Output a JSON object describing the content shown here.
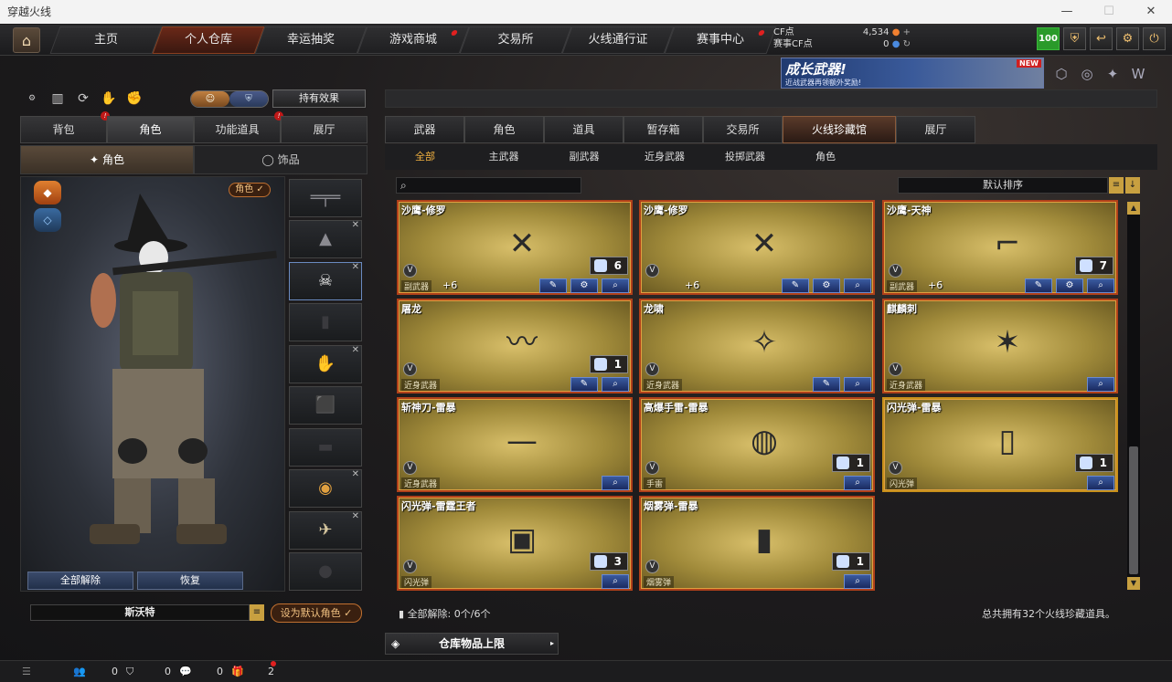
{
  "window": {
    "title": "穿越火线",
    "minimize": "—",
    "maximize": "☐",
    "close": "✕"
  },
  "nav": {
    "tabs": [
      {
        "label": "主页"
      },
      {
        "label": "个人仓库"
      },
      {
        "label": "幸运抽奖"
      },
      {
        "label": "游戏商城"
      },
      {
        "label": "交易所"
      },
      {
        "label": "火线通行证"
      },
      {
        "label": "赛事中心"
      }
    ],
    "active_index": 1
  },
  "currency": {
    "cf_label": "CF点",
    "cf_value": "4,534",
    "event_label": "赛事CF点",
    "event_value": "0"
  },
  "top_icons": {
    "level": "100"
  },
  "banner": {
    "title": "成长武器!",
    "subtitle": "近战武器再领额外奖励!",
    "badge": "NEW"
  },
  "left": {
    "effects_button": "持有效果",
    "tabs": [
      {
        "label": "背包",
        "warn": true
      },
      {
        "label": "角色",
        "warn": false
      },
      {
        "label": "功能道具",
        "warn": true
      },
      {
        "label": "展厅",
        "warn": false
      }
    ],
    "active_tab": 1,
    "subtabs": [
      {
        "label": "角色"
      },
      {
        "label": "饰品"
      }
    ],
    "character_badge": "角色 ✓",
    "unequip_all": "全部解除",
    "restore": "恢复",
    "character_name": "斯沃特",
    "set_default": "设为默认角色 ✓"
  },
  "right": {
    "tabs": [
      {
        "label": "武器"
      },
      {
        "label": "角色"
      },
      {
        "label": "道具"
      },
      {
        "label": "暂存箱"
      },
      {
        "label": "交易所"
      },
      {
        "label": "火线珍藏馆"
      },
      {
        "label": "展厅"
      }
    ],
    "active_tab": 5,
    "categories": [
      {
        "label": "全部"
      },
      {
        "label": "主武器"
      },
      {
        "label": "副武器"
      },
      {
        "label": "近身武器"
      },
      {
        "label": "投掷武器"
      },
      {
        "label": "角色"
      }
    ],
    "active_category": 0,
    "search_placeholder": "",
    "sort_label": "默认排序",
    "items": [
      {
        "name": "沙鹰-修罗",
        "type": "副武器",
        "plus": "+6",
        "count": "6"
      },
      {
        "name": "沙鹰-修罗",
        "type": "",
        "plus": "+6",
        "count": ""
      },
      {
        "name": "沙鹰-天神",
        "type": "副武器",
        "plus": "+6",
        "count": "7"
      },
      {
        "name": "屠龙",
        "type": "近身武器",
        "plus": "",
        "count": "1"
      },
      {
        "name": "龙啸",
        "type": "近身武器",
        "plus": "",
        "count": ""
      },
      {
        "name": "麒麟刺",
        "type": "近身武器",
        "plus": "",
        "count": ""
      },
      {
        "name": "斩神刀-雷暴",
        "type": "近身武器",
        "plus": "",
        "count": ""
      },
      {
        "name": "高爆手雷-雷暴",
        "type": "手雷",
        "plus": "",
        "count": "1"
      },
      {
        "name": "闪光弹-雷暴",
        "type": "闪光弹",
        "plus": "",
        "count": "1"
      },
      {
        "name": "闪光弹-雷霆王者",
        "type": "闪光弹",
        "plus": "",
        "count": "3"
      },
      {
        "name": "烟雾弹-雷暴",
        "type": "烟雾弹",
        "plus": "",
        "count": "1"
      }
    ],
    "footer_left": "全部解除: 0个/6个",
    "footer_right": "总共拥有32个火线珍藏道具。",
    "capacity_button": "仓库物品上限"
  },
  "status": {
    "friends": "0",
    "shield": "0",
    "chat": "0",
    "gift": "2"
  }
}
